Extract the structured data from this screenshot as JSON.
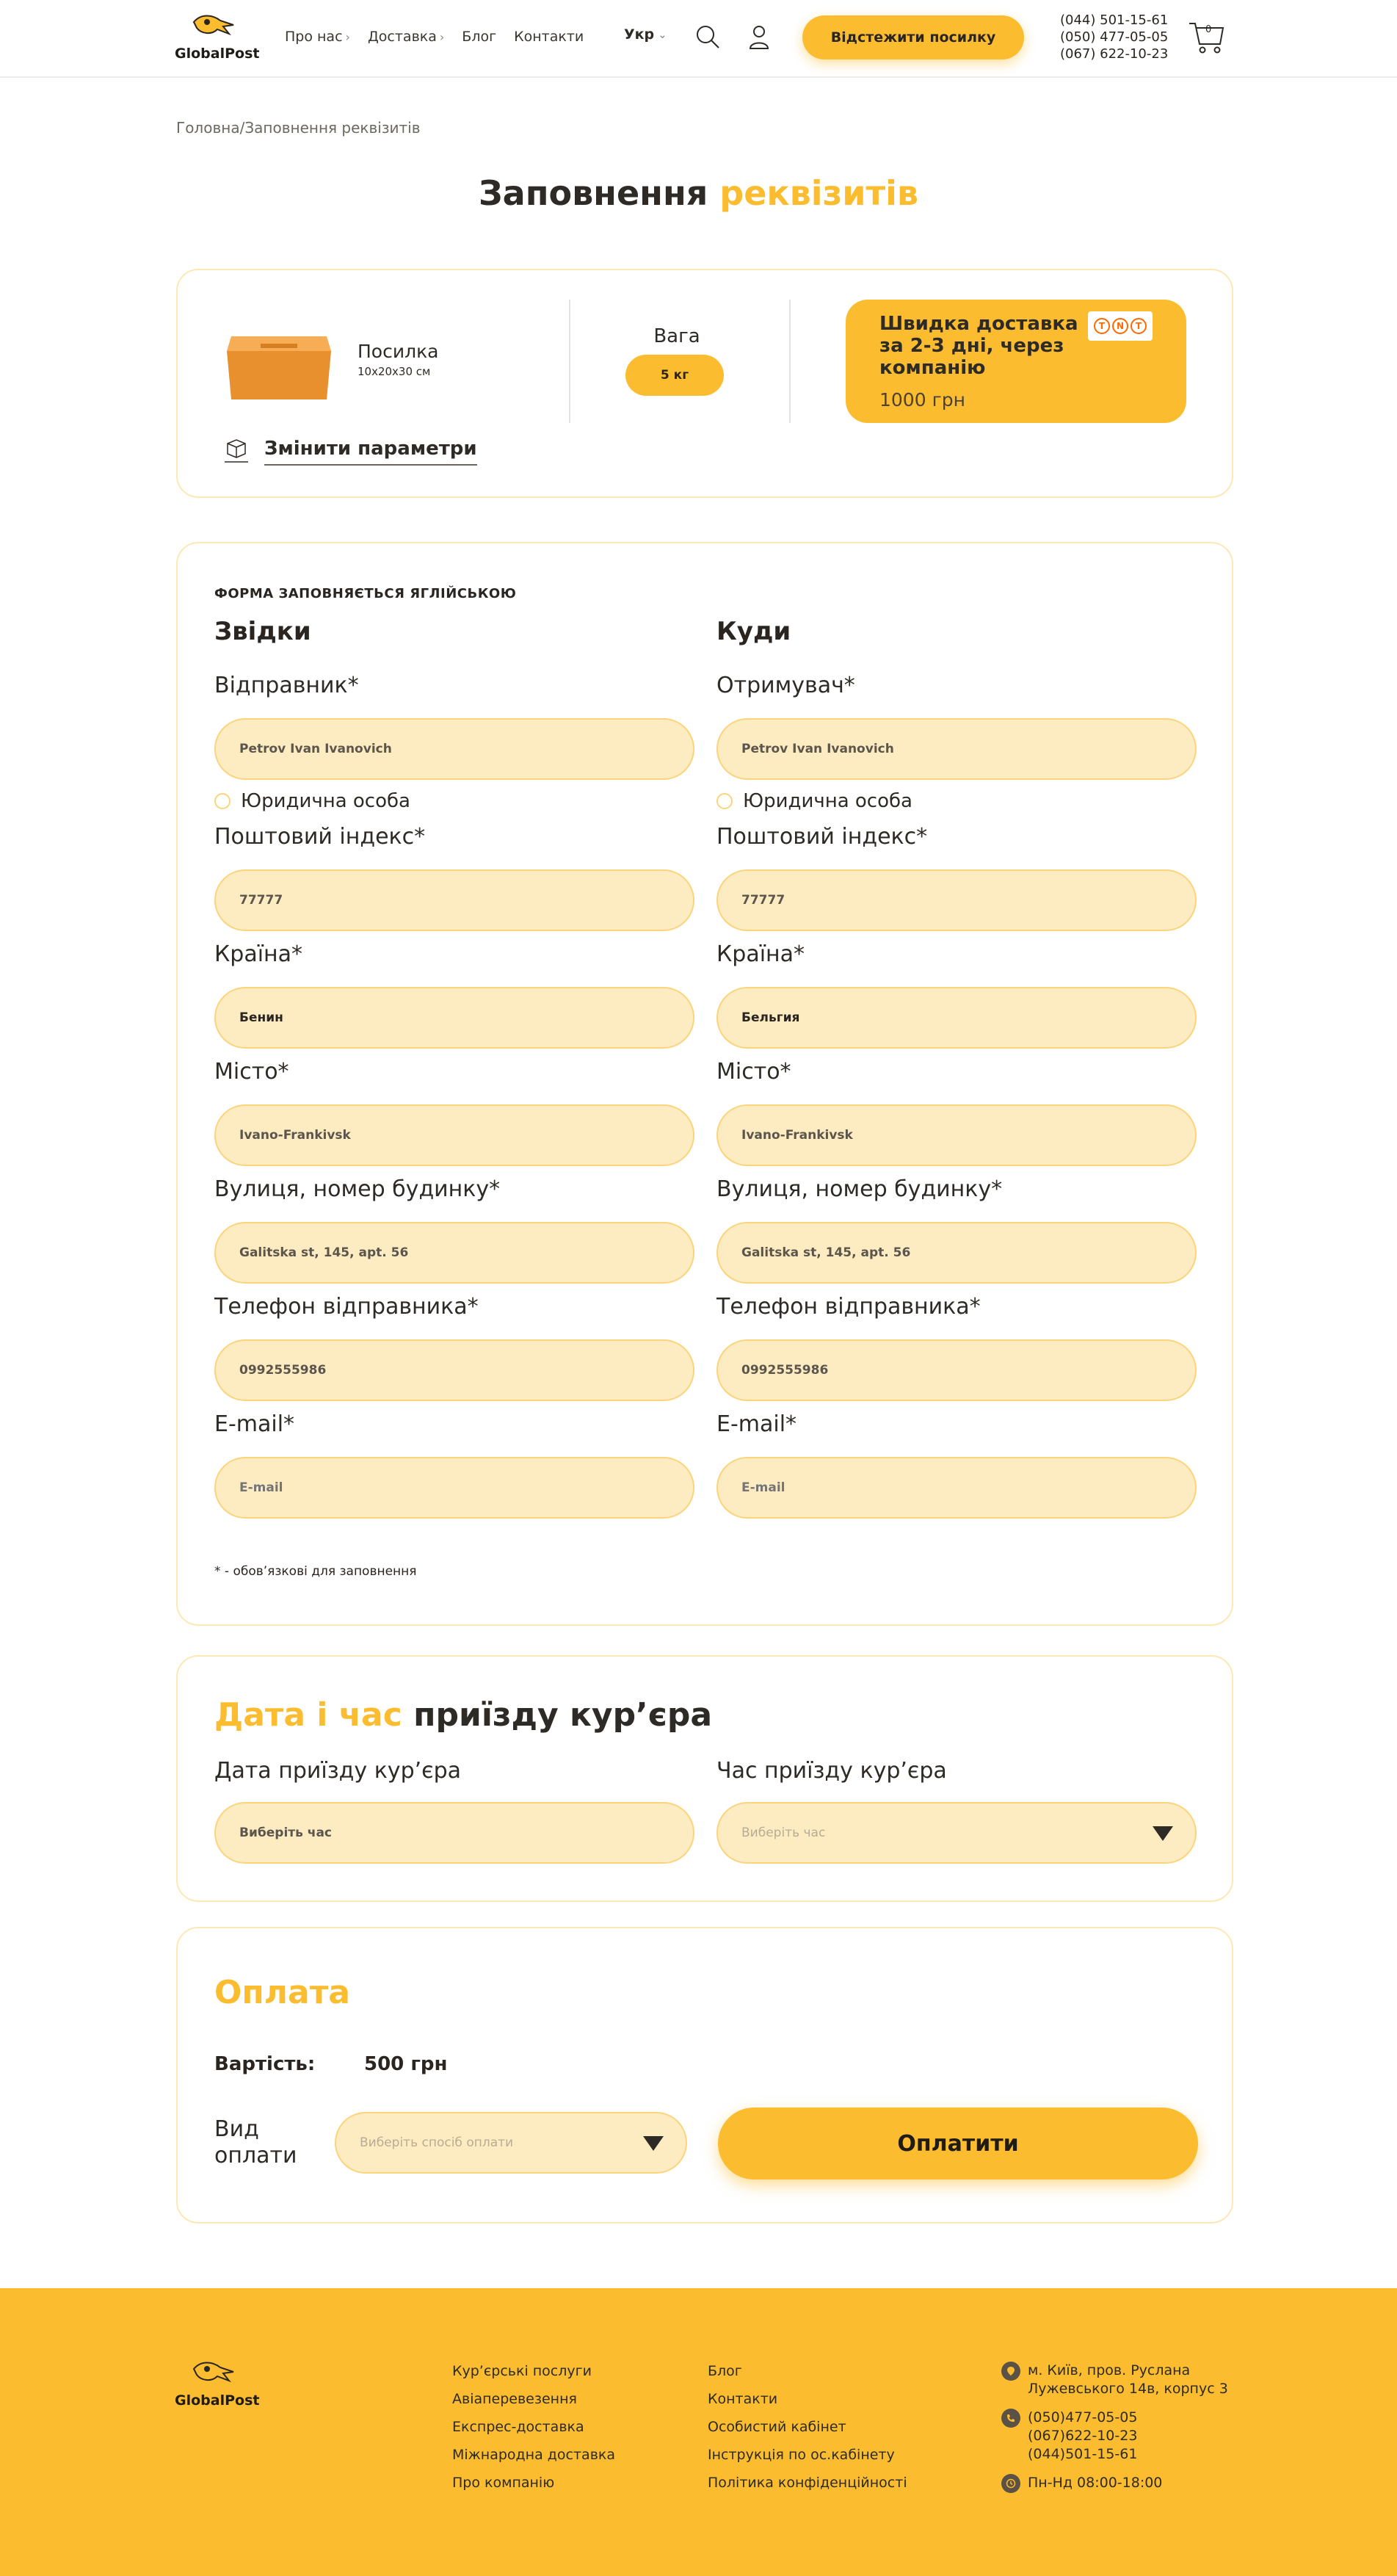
{
  "header": {
    "logo_text": "GlobalPost",
    "nav": [
      {
        "label": "Про нас",
        "has_dropdown": true
      },
      {
        "label": "Доставка",
        "has_dropdown": true
      },
      {
        "label": "Блог",
        "has_dropdown": false
      },
      {
        "label": "Контакти",
        "has_dropdown": false
      }
    ],
    "language": "Укр",
    "track_button": "Відстежити посилку",
    "phones": [
      "(044) 501-15-61",
      "(050) 477-05-05",
      "(067) 622-10-23"
    ],
    "cart_count": "0"
  },
  "breadcrumb": {
    "home": "Головна",
    "separator": "/",
    "current": "Заповнення реквізитів"
  },
  "page_title": {
    "part1": "Заповнення",
    "part2": "реквізитів"
  },
  "summary": {
    "parcel_name": "Посилка",
    "parcel_dims": "10x20x30 см",
    "change_params": "Змінити параметри",
    "weight_label": "Вага",
    "weight_value": "5 кг",
    "delivery_title": "Швидка доставка за 2-3 дні, через компанію",
    "delivery_price": "1000 грн",
    "carrier_logo": "TNT"
  },
  "form": {
    "note": "ФОРМА ЗАПОВНЯЄТЬСЯ ЯГЛІЙСЬКОЮ",
    "from_title": "Звідки",
    "to_title": "Куди",
    "legal_entity": "Юридична особа",
    "required_note": "* - обов’язкові для заповнення",
    "from": {
      "sender_label": "Відправник*",
      "sender_value": "Petrov Ivan Ivanovich",
      "zip_label": "Поштовий індекс*",
      "zip_value": "77777",
      "country_label": "Країна*",
      "country_value": "Бенин",
      "city_label": "Місто*",
      "city_value": "Ivano-Frankivsk",
      "street_label": "Вулиця, номер будинку*",
      "street_value": "Galitska st, 145, apt. 56",
      "phone_label": "Телефон відправника*",
      "phone_value": "0992555986",
      "email_label": "E-mail*",
      "email_placeholder": "E-mail"
    },
    "to": {
      "recipient_label": "Отримувач*",
      "recipient_value": "Petrov Ivan Ivanovich",
      "zip_label": "Поштовий індекс*",
      "zip_value": "77777",
      "country_label": "Країна*",
      "country_value": "Бельгия",
      "city_label": "Місто*",
      "city_value": "Ivano-Frankivsk",
      "street_label": "Вулиця, номер будинку*",
      "street_value": "Galitska st, 145, apt. 56",
      "phone_label": "Телефон відправника*",
      "phone_value": "0992555986",
      "email_label": "E-mail*",
      "email_placeholder": "E-mail"
    }
  },
  "courier": {
    "title_accent": "Дата і час",
    "title_rest": "приїзду кур’єра",
    "date_label": "Дата приїзду кур’єра",
    "date_value": "Виберіть час",
    "time_label": "Час приїзду кур’єра",
    "time_placeholder": "Виберіть час"
  },
  "payment": {
    "title": "Оплата",
    "cost_label": "Вартість:",
    "cost_value": "500 грн",
    "method_label": "Вид оплати",
    "method_placeholder": "Виберіть спосіб оплати",
    "pay_button": "Оплатити"
  },
  "footer": {
    "logo_text": "GlobalPost",
    "col1": [
      "Кур’єрські послуги",
      "Авіаперевезення",
      "Експрес-доставка",
      "Міжнародна доставка",
      "Про компанію"
    ],
    "col2": [
      "Блог",
      "Контакти",
      "Особистий кабінет",
      "Інструкція по ос.кабінету",
      "Політика конфіденційності"
    ],
    "address": "м. Київ, пров. Руслана Лужевського 14в, корпус 3",
    "phones": [
      "(050)477-05-05",
      "(067)622-10-23",
      "(044)501-15-61"
    ],
    "hours": "Пн-Нд 08:00-18:00"
  },
  "colors": {
    "accent": "#fbbd2f",
    "input_bg": "#fdebc1",
    "text": "#2e2a26"
  }
}
